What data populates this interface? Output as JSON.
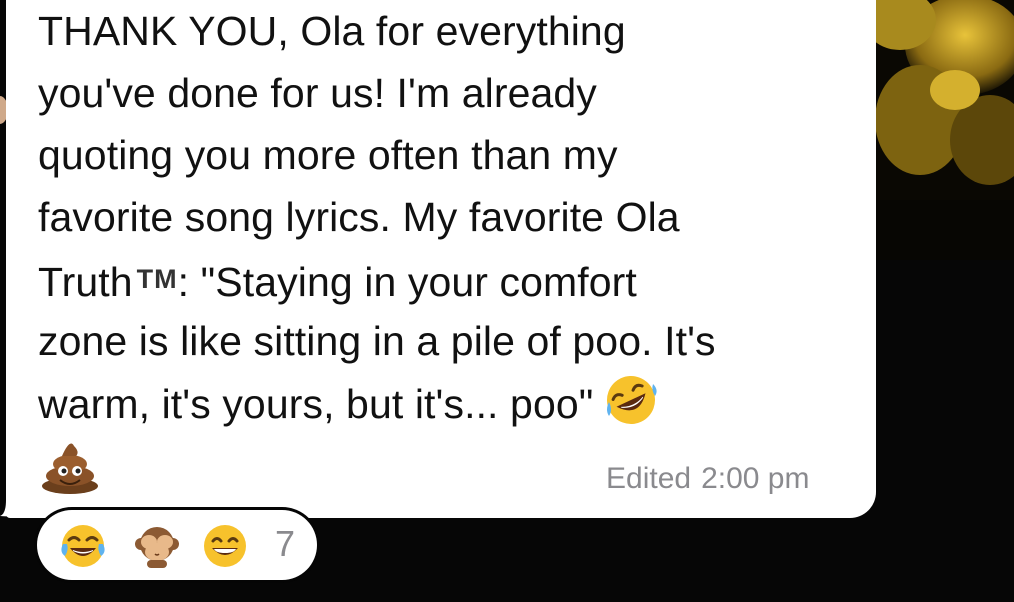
{
  "message": {
    "lines": [
      "THANK YOU, Ola for everything",
      "you've done for us! I'm already",
      "quoting you more often than my",
      "favorite song lyrics. My favorite Ola",
      "Truth",
      ": \"Staying in your comfort",
      "zone is like sitting in a pile of poo. It's",
      "warm, it's yours, but it's... poo\""
    ],
    "trademark": "TM",
    "inline_emoji": "rolling-on-floor-laughing-icon",
    "trailing_emoji": "pile-of-poo-icon"
  },
  "meta": {
    "edited_label": "Edited",
    "time": "2:00 pm"
  },
  "reactions": {
    "emojis": [
      "face-with-tears-of-joy-icon",
      "see-no-evil-monkey-icon",
      "grinning-face-icon"
    ],
    "count": "7"
  },
  "colors": {
    "bubble": "#ffffff",
    "background": "#060606",
    "text": "#111111",
    "meta": "#8a8a8e",
    "emoji_yellow": "#f7c22c"
  }
}
